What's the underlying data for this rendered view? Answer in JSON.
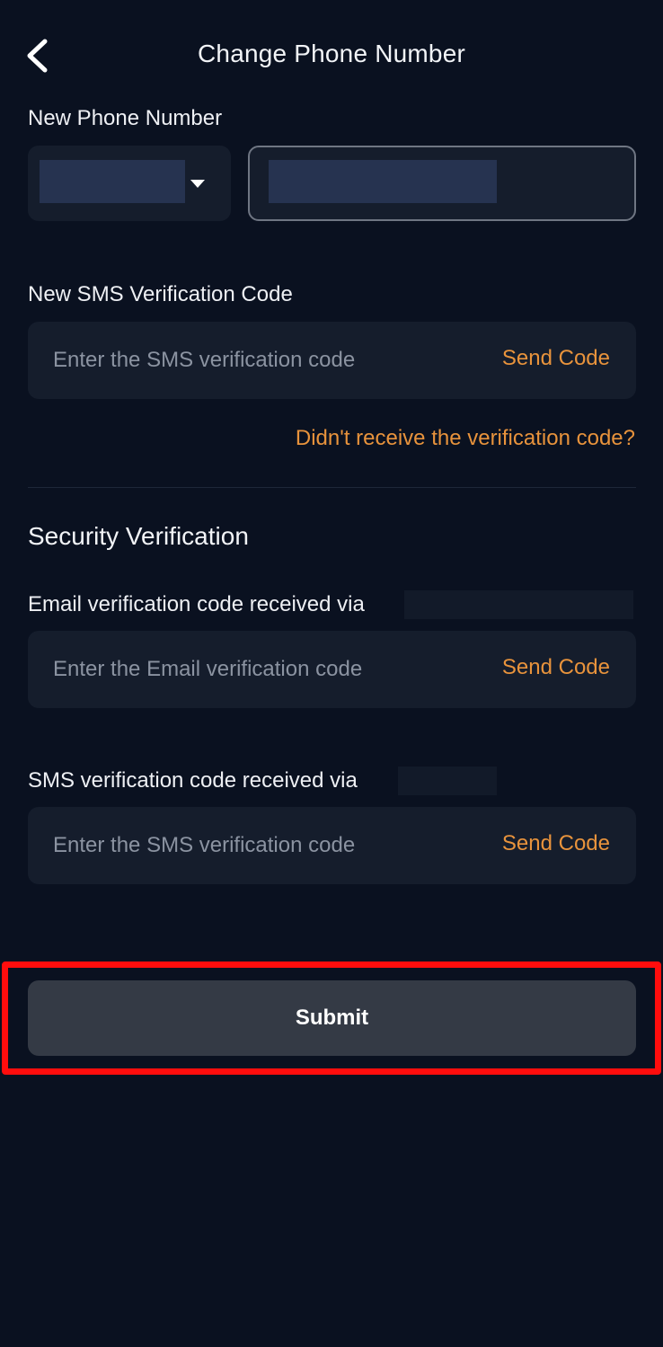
{
  "header": {
    "title": "Change Phone Number",
    "back_icon": "chevron-left-icon"
  },
  "new_phone": {
    "label": "New Phone Number",
    "country_code_value": "",
    "phone_value": "",
    "dropdown_icon": "caret-down-icon"
  },
  "new_sms": {
    "label": "New SMS Verification Code",
    "placeholder": "Enter the SMS verification code",
    "send_code": "Send Code",
    "help_link": "Didn't receive the verification code?"
  },
  "security": {
    "title": "Security Verification",
    "email": {
      "label": "Email verification code received via",
      "placeholder": "Enter the Email verification code",
      "send_code": "Send Code"
    },
    "sms": {
      "label": "SMS verification code received via",
      "placeholder": "Enter the SMS verification code",
      "send_code": "Send Code"
    }
  },
  "submit": {
    "label": "Submit"
  },
  "colors": {
    "background": "#0a1120",
    "field": "#151d2c",
    "accent": "#e8933c",
    "button": "#343a45",
    "highlight": "#ff0d0d"
  }
}
